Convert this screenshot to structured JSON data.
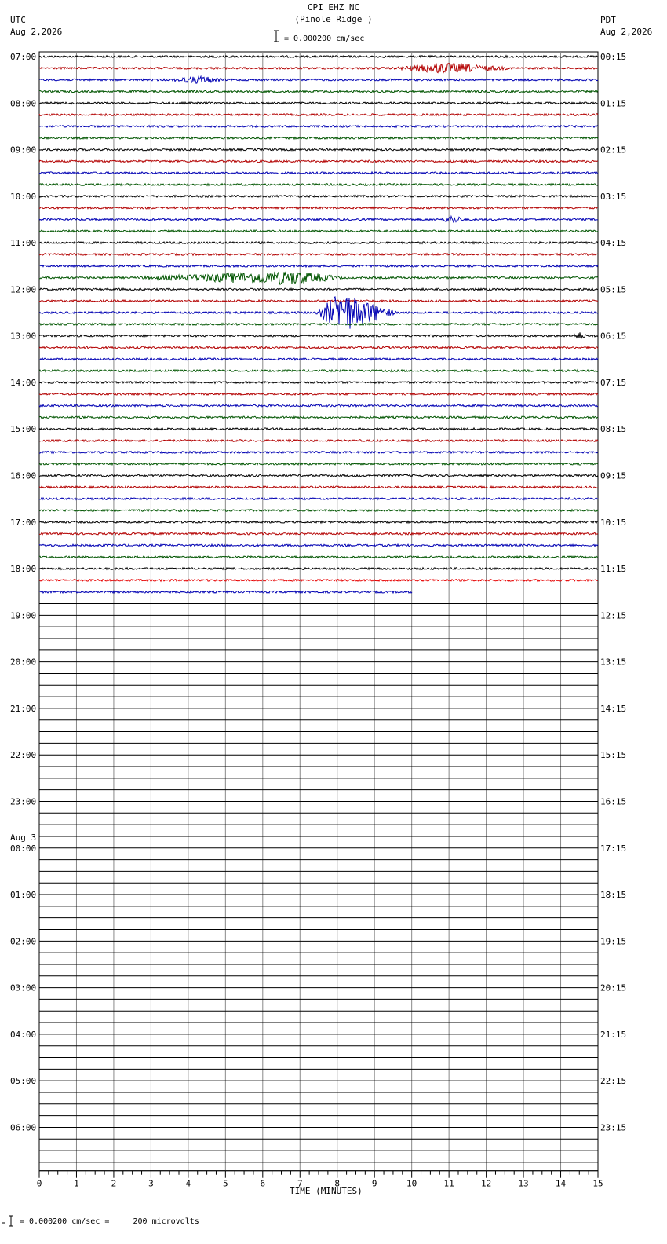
{
  "header": {
    "station": "CPI EHZ NC",
    "site": "(Pinole Ridge )",
    "scale": "= 0.000200 cm/sec",
    "left_tz": "UTC",
    "left_date": "Aug 2,2026",
    "right_tz": "PDT",
    "right_date": "Aug 2,2026"
  },
  "footer": {
    "scale_note": "= 0.000200 cm/sec =     200 microvolts"
  },
  "chart_data": {
    "type": "line",
    "title": "CPI EHZ NC (Pinole Ridge )",
    "xlabel": "TIME (MINUTES)",
    "xlim": [
      0,
      15
    ],
    "x_ticks": [
      "0",
      "1",
      "2",
      "3",
      "4",
      "5",
      "6",
      "7",
      "8",
      "9",
      "10",
      "11",
      "12",
      "13",
      "14",
      "15"
    ],
    "rows_total": 96,
    "rows_per_hour": 4,
    "trace_colors": [
      "#000000",
      "#b30000",
      "#0000b3",
      "#005500"
    ],
    "current_trace_color": "#e60000",
    "utc_labels": [
      "07:00",
      "08:00",
      "09:00",
      "10:00",
      "11:00",
      "12:00",
      "13:00",
      "14:00",
      "15:00",
      "16:00",
      "17:00",
      "18:00",
      "19:00",
      "20:00",
      "21:00",
      "22:00",
      "23:00",
      "00:00",
      "01:00",
      "02:00",
      "03:00",
      "04:00",
      "05:00",
      "06:00"
    ],
    "day_change_label": "Aug 3",
    "day_change_hour_index": 17,
    "pdt_labels": [
      "00:15",
      "01:15",
      "02:15",
      "03:15",
      "04:15",
      "05:15",
      "06:15",
      "07:15",
      "08:15",
      "09:15",
      "10:15",
      "11:15",
      "12:15",
      "13:15",
      "14:15",
      "15:15",
      "16:15",
      "17:15",
      "18:15",
      "19:15",
      "20:15",
      "21:15",
      "22:15",
      "23:15"
    ],
    "data_end": {
      "row": 46,
      "minute": 10
    },
    "events": [
      {
        "row": 1,
        "start_min": 9.5,
        "end_min": 12.7,
        "peak_min": 10.8,
        "amplitude": 0.6
      },
      {
        "row": 2,
        "start_min": 3.5,
        "end_min": 5.0,
        "peak_min": 4.3,
        "amplitude": 0.4
      },
      {
        "row": 14,
        "start_min": 10.8,
        "end_min": 11.4,
        "peak_min": 11.1,
        "amplitude": 0.5
      },
      {
        "row": 19,
        "start_min": 2.5,
        "end_min": 8.2,
        "peak_min": 6.8,
        "amplitude": 0.8
      },
      {
        "row": 22,
        "start_min": 7.4,
        "end_min": 9.6,
        "peak_min": 8.1,
        "amplitude": 2.5
      },
      {
        "row": 24,
        "start_min": 14.3,
        "end_min": 14.7,
        "peak_min": 14.5,
        "amplitude": 0.4
      }
    ]
  }
}
